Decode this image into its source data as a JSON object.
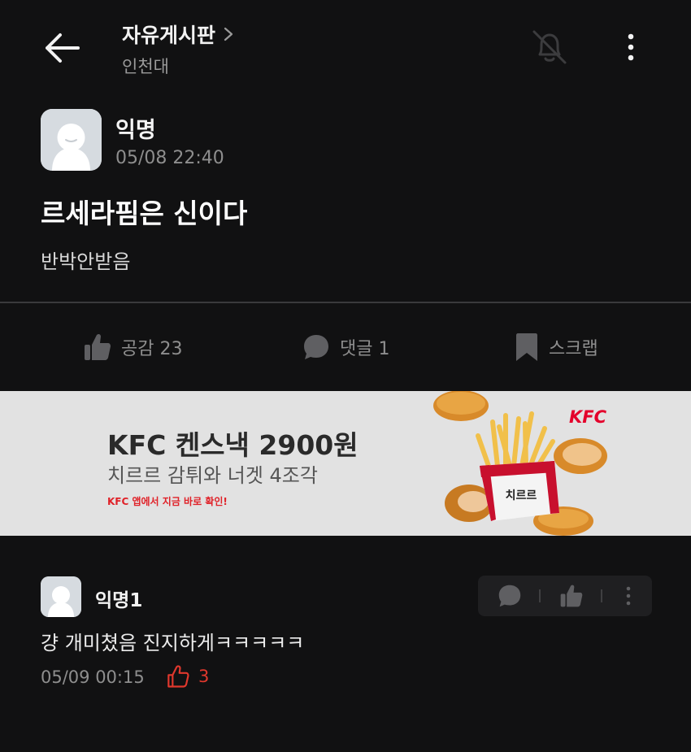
{
  "header": {
    "board_title": "자유게시판",
    "board_subtitle": "인천대"
  },
  "post": {
    "author": "익명",
    "datetime": "05/08 22:40",
    "title": "르세라핌은 신이다",
    "body": "반박안받음"
  },
  "actions": {
    "like_label": "공감 23",
    "comment_label": "댓글 1",
    "scrap_label": "스크랩"
  },
  "ad": {
    "title": "KFC 켄스낵 2900원",
    "subtitle": "치르르 감튀와 너겟 4조각",
    "small_text": "KFC 앱에서 지금 바로 확인!",
    "brand": "KFC",
    "box_text": "치르르"
  },
  "comments": [
    {
      "author": "익명1",
      "text": "걍 개미쳤음 진지하게ㅋㅋㅋㅋㅋ",
      "datetime": "05/09 00:15",
      "likes": "3"
    }
  ],
  "icons": {
    "back": "back-arrow-icon",
    "chevron": "chevron-right-icon",
    "bell_off": "bell-off-icon",
    "more": "more-vertical-icon",
    "like": "thumbs-up-icon",
    "comment": "speech-bubble-icon",
    "scrap": "bookmark-icon"
  },
  "colors": {
    "background": "#111112",
    "muted_text": "#8e8e8e",
    "like_red": "#e0382d",
    "kfc_red": "#e4002b",
    "ad_background": "#e2e2e2"
  }
}
